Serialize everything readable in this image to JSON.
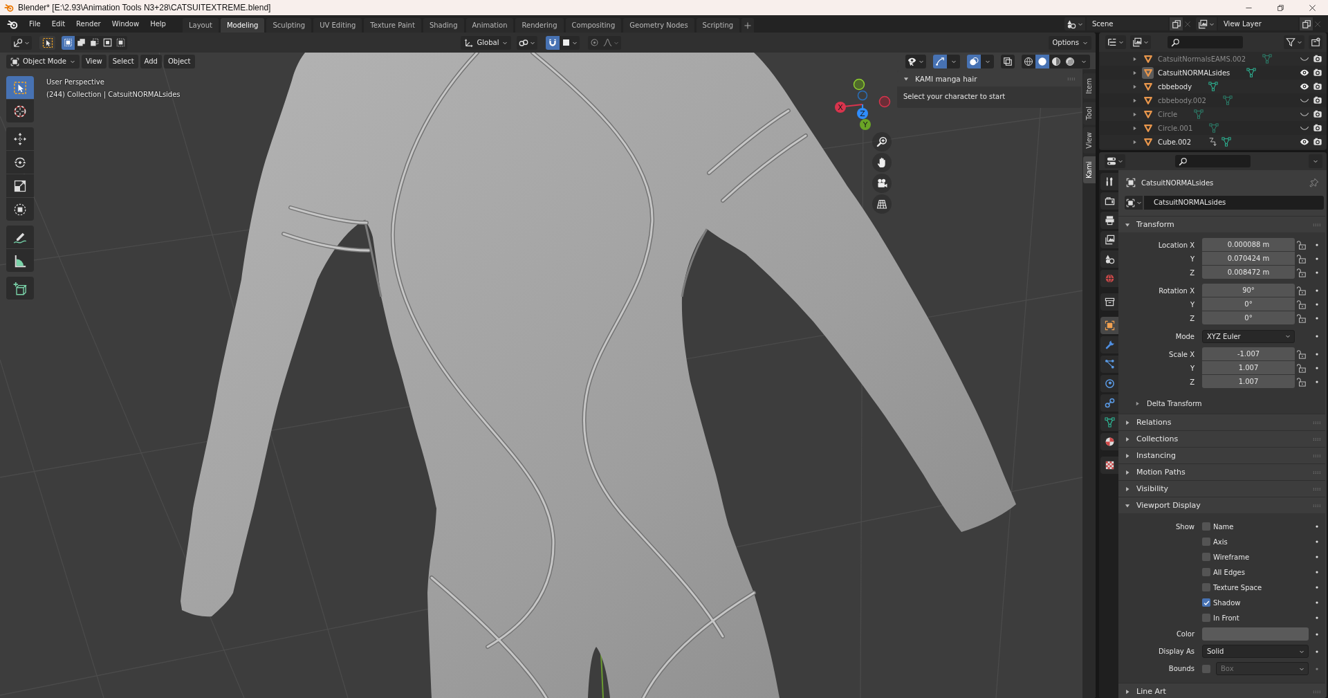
{
  "window": {
    "title": "Blender* [E:\\2.93\\Animation Tools N3+28\\CATSUITEXTREME.blend]"
  },
  "menu": [
    "File",
    "Edit",
    "Render",
    "Window",
    "Help"
  ],
  "workspaces": [
    {
      "label": "Layout",
      "selected": false
    },
    {
      "label": "Modeling",
      "selected": true
    },
    {
      "label": "Sculpting",
      "selected": false
    },
    {
      "label": "UV Editing",
      "selected": false
    },
    {
      "label": "Texture Paint",
      "selected": false
    },
    {
      "label": "Shading",
      "selected": false
    },
    {
      "label": "Animation",
      "selected": false
    },
    {
      "label": "Rendering",
      "selected": false
    },
    {
      "label": "Compositing",
      "selected": false
    },
    {
      "label": "Geometry Nodes",
      "selected": false
    },
    {
      "label": "Scripting",
      "selected": false
    }
  ],
  "scene": {
    "value": "Scene"
  },
  "view_layer": {
    "value": "View Layer"
  },
  "viewport_header": {
    "select_modes": [
      {
        "selected": true
      },
      {
        "selected": false
      },
      {
        "selected": false
      },
      {
        "selected": false
      },
      {
        "selected": false
      }
    ],
    "orientation": "Global",
    "snapping": {
      "on": true
    },
    "proportional": {
      "on": false
    },
    "options": "Options",
    "mode": "Object Mode",
    "menus": [
      "View",
      "Select",
      "Add",
      "Object"
    ],
    "gizmos": {
      "on": true
    },
    "overlays": {
      "on": true
    },
    "xray": {
      "on": false
    },
    "shading": [
      {
        "selected": false
      },
      {
        "selected": true
      },
      {
        "selected": false
      },
      {
        "selected": false
      }
    ]
  },
  "toolbar": [
    {
      "selected": true
    },
    {
      "selected": false
    },
    {
      "selected": false
    },
    {
      "selected": false
    },
    {
      "selected": false
    },
    {
      "selected": false
    },
    {
      "selected": false
    },
    {
      "selected": false
    },
    {
      "selected": false
    }
  ],
  "info": [
    "User Perspective",
    "(244) Collection | CatsuitNORMALsides"
  ],
  "gizmo_axes": [
    "X",
    "Z",
    "Y"
  ],
  "sidebar": {
    "tabs": [
      {
        "label": "Item",
        "selected": false
      },
      {
        "label": "Tool",
        "selected": false
      },
      {
        "label": "View",
        "selected": false
      },
      {
        "label": "Kami",
        "selected": true
      }
    ],
    "panel": {
      "title": "KAMI manga hair",
      "expanded": true,
      "text": "Select your character to start"
    }
  },
  "outliner": {
    "rows": [
      {
        "name": "CatsuitNormalsEAMS.002",
        "visible": false,
        "active": false,
        "arrow_icon": false
      },
      {
        "name": "CatsuitNORMALsides",
        "visible": true,
        "active": true,
        "arrow_icon": false
      },
      {
        "name": "cbbebody",
        "visible": true,
        "active": false,
        "arrow_icon": false
      },
      {
        "name": "cbbebody.002",
        "visible": false,
        "active": false,
        "arrow_icon": false
      },
      {
        "name": "Circle",
        "visible": false,
        "active": false,
        "arrow_icon": false
      },
      {
        "name": "Circle.001",
        "visible": false,
        "active": false,
        "arrow_icon": false
      },
      {
        "name": "Cube.002",
        "visible": true,
        "active": false,
        "arrow_icon": true
      }
    ]
  },
  "properties": {
    "tabs": [
      {
        "selected": false
      },
      {
        "selected": false
      },
      {
        "selected": false
      },
      {
        "selected": false
      },
      {
        "selected": false
      },
      {
        "selected": false
      },
      {
        "selected": false
      },
      {
        "selected": true
      },
      {
        "selected": false
      },
      {
        "selected": false
      },
      {
        "selected": false
      },
      {
        "selected": false
      },
      {
        "selected": false
      },
      {
        "selected": false
      },
      {
        "selected": false
      }
    ],
    "object_name": "CatsuitNORMALsides",
    "datablock": "CatsuitNORMALsides",
    "sections": [
      {
        "kind": "transform",
        "title": "Transform",
        "expanded": true,
        "groups": [
          {
            "rows": [
              {
                "label": "Location X",
                "value": "0.000088 m",
                "kind": "number"
              },
              {
                "label": "Y",
                "value": "0.070424 m",
                "kind": "number"
              },
              {
                "label": "Z",
                "value": "0.008472 m",
                "kind": "number"
              }
            ]
          },
          {
            "rows": [
              {
                "label": "Rotation X",
                "value": "90°",
                "kind": "number"
              },
              {
                "label": "Y",
                "value": "0°",
                "kind": "number"
              },
              {
                "label": "Z",
                "value": "0°",
                "kind": "number"
              }
            ]
          },
          {
            "rows": [
              {
                "label": "Mode",
                "value": "XYZ Euler",
                "kind": "dropdown"
              }
            ]
          },
          {
            "rows": [
              {
                "label": "Scale X",
                "value": "-1.007",
                "kind": "number"
              },
              {
                "label": "Y",
                "value": "1.007",
                "kind": "number"
              },
              {
                "label": "Z",
                "value": "1.007",
                "kind": "number"
              }
            ]
          }
        ],
        "subpanel": {
          "title": "Delta Transform",
          "expanded": false
        }
      },
      {
        "kind": "plain",
        "title": "Relations",
        "expanded": false
      },
      {
        "kind": "plain",
        "title": "Collections",
        "expanded": false
      },
      {
        "kind": "plain",
        "title": "Instancing",
        "expanded": false
      },
      {
        "kind": "plain",
        "title": "Motion Paths",
        "expanded": false
      },
      {
        "kind": "plain",
        "title": "Visibility",
        "expanded": false
      },
      {
        "kind": "display",
        "title": "Viewport Display",
        "expanded": true,
        "show_label": "Show",
        "checks": [
          {
            "label": "Name",
            "checked": false
          },
          {
            "label": "Axis",
            "checked": false
          },
          {
            "label": "Wireframe",
            "checked": false
          },
          {
            "label": "All Edges",
            "checked": false
          },
          {
            "label": "Texture Space",
            "checked": false
          },
          {
            "label": "Shadow",
            "checked": true
          },
          {
            "label": "In Front",
            "checked": false
          }
        ],
        "color_label": "Color",
        "display_as": {
          "label": "Display As",
          "value": "Solid"
        },
        "bounds": {
          "label": "Bounds",
          "checked": false,
          "value": "Box",
          "disabled": true
        }
      },
      {
        "kind": "plain",
        "title": "Line Art",
        "expanded": false
      }
    ]
  }
}
